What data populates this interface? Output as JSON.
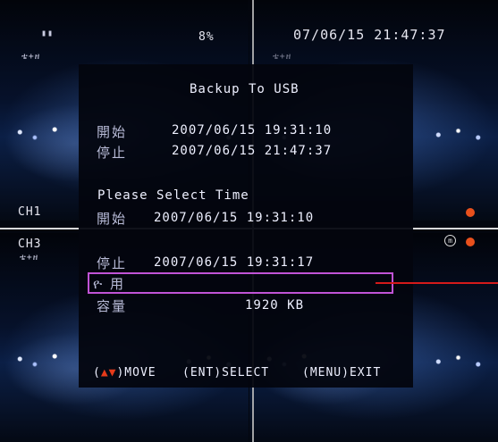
{
  "osd": {
    "percent": "8%",
    "datetime": "07/06/15 21:47:37",
    "ch1": "CH1",
    "ch3": "CH3",
    "cam_small": "ቴ+ዘ"
  },
  "menu": {
    "title": "Backup To USB",
    "range_start_label": "開始",
    "range_start_value": "2007/06/15 19:31:10",
    "range_stop_label": "停止",
    "range_stop_value": "2007/06/15 21:47:37",
    "prompt": "Please Select Time",
    "select_start_label": "開始",
    "select_start_value": "2007/06/15 19:31:10",
    "select_stop_label": "停止",
    "select_stop_value": "2007/06/15 19:31:17",
    "use_label": "ዮ 用",
    "capacity_label": "容量",
    "capacity_value": "1920 KB"
  },
  "hints": {
    "move": ")MOVE",
    "select": "(ENT)SELECT",
    "exit": "(MENU)EXIT",
    "move_open": "(",
    "arrow": "▲▼"
  },
  "colors": {
    "highlight_border": "#c053d6",
    "record_dot": "#e8501c",
    "pointer_line": "#d41a1a"
  }
}
